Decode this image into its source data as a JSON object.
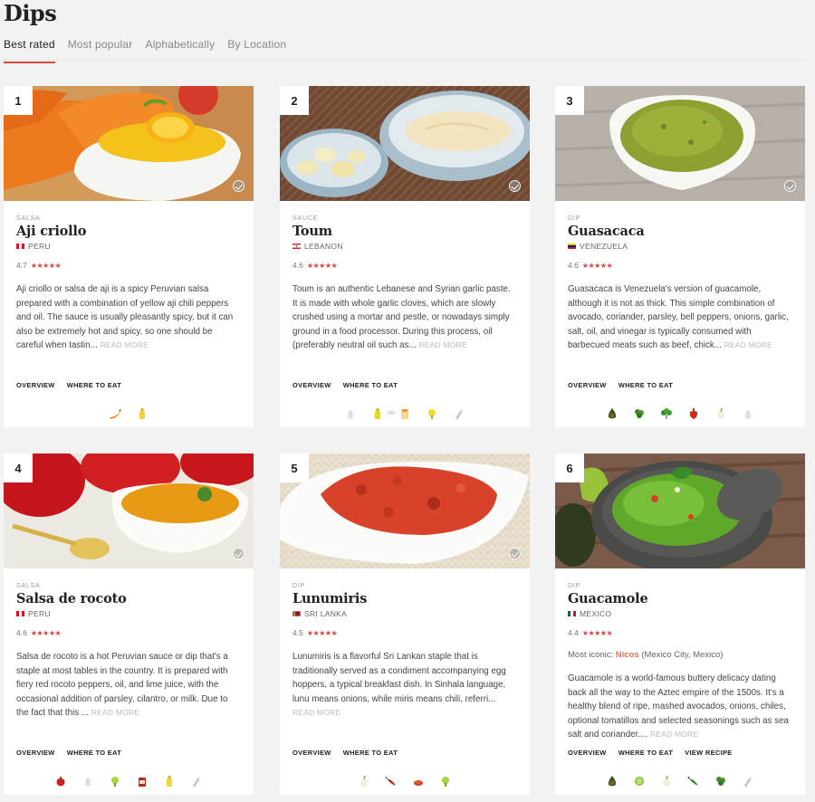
{
  "page_title": "Dips",
  "tabs": [
    {
      "label": "Best rated",
      "active": true
    },
    {
      "label": "Most popular",
      "active": false
    },
    {
      "label": "Alphabetically",
      "active": false
    },
    {
      "label": "By Location",
      "active": false
    }
  ],
  "card_links": {
    "overview": "OVERVIEW",
    "where_to_eat": "WHERE TO EAT",
    "view_recipe": "VIEW RECIPE"
  },
  "read_more": "READ MORE",
  "accent_color": "#d24a3c",
  "dishes": [
    {
      "rank": "1",
      "category": "SALSA",
      "name": "Aji criollo",
      "country": "PERU",
      "flag": "peru-flag",
      "rating": "4.7",
      "stars": "★★★★★",
      "description": "Aji criollo or salsa de aji is a spicy Peruvian salsa prepared with a combination of yellow aji chili peppers and oil. The sauce is usually pleasantly spicy, but it can also be extremely hot and spicy, so one should be careful when tastin...",
      "ingredients": [
        "aji-pepper-icon",
        "oil-icon"
      ]
    },
    {
      "rank": "2",
      "category": "SAUCE",
      "name": "Toum",
      "country": "LEBANON",
      "flag": "lebanon-flag",
      "rating": "4.6",
      "stars": "★★★★★",
      "description": "Toum is an authentic Lebanese and Syrian garlic paste. It is made with whole garlic cloves, which are slowly crushed using a mortar and pestle, or nowadays simply ground in a food processor. During this process, oil (preferably neutral oil such as...",
      "ingredients": [
        "garlic-icon",
        "oil-icon",
        "mayonnaise-icon",
        "lemon-juice-icon",
        "salt-icon"
      ],
      "or_label": "OR"
    },
    {
      "rank": "3",
      "category": "DIP",
      "name": "Guasacaca",
      "country": "VENEZUELA",
      "flag": "venezuela-flag",
      "rating": "4.6",
      "stars": "★★★★★",
      "description": "Guasacaca is Venezuela's version of guacamole, although it is not as thick. This simple combination of avocado, coriander, parsley, bell peppers, onions, garlic, salt, oil, and vinegar is typically consumed with barbecued meats such as beef, chick...",
      "ingredients": [
        "avocado-icon",
        "coriander-icon",
        "parsley-icon",
        "bell-pepper-icon",
        "onion-icon",
        "garlic-icon"
      ]
    },
    {
      "rank": "4",
      "category": "SALSA",
      "name": "Salsa de rocoto",
      "country": "PERU",
      "flag": "peru-flag",
      "rating": "4.6",
      "stars": "★★★★★",
      "description": "Salsa de rocoto is a hot Peruvian sauce or dip that's a staple at most tables in the country. It is prepared with fiery red rocoto peppers, oil, and lime juice, with the occasional addition of parsley, cilantro, or milk. Due to the fact that this ...",
      "ingredients": [
        "rocoto-pepper-icon",
        "garlic-icon",
        "lime-juice-icon",
        "tomato-paste-icon",
        "oil-icon",
        "salt-icon"
      ]
    },
    {
      "rank": "5",
      "category": "DIP",
      "name": "Lunumiris",
      "country": "SRI LANKA",
      "flag": "sri-lanka-flag",
      "rating": "4.5",
      "stars": "★★★★★",
      "description": "Lunumiris is a flavorful Sri Lankan staple that is traditionally served as a condiment accompanying egg hoppers, a typical breakfast dish. In Sinhala language, lunu means onions, while miris means chili, referri...",
      "ingredients": [
        "onion-icon",
        "chili-icon",
        "chili-flakes-icon",
        "lime-juice-icon"
      ]
    },
    {
      "rank": "6",
      "category": "DIP",
      "name": "Guacamole",
      "country": "MEXICO",
      "flag": "mexico-flag",
      "rating": "4.4",
      "stars": "★★★★★",
      "iconic_label": "Most iconic:",
      "iconic_place": "Nicos",
      "iconic_location": "(Mexico City, Mexico)",
      "description": "Guacamole is a world-famous buttery delicacy dating back all the way to the Aztec empire of the 1500s. It's a healthy blend of ripe, mashed avocados, onions, chiles, optional tomatillos and selected seasonings such as sea salt and coriander....",
      "ingredients": [
        "avocado-icon",
        "lime-icon",
        "onion-icon",
        "chile-icon",
        "coriander-icon",
        "salt-icon"
      ],
      "has_recipe": true
    }
  ]
}
